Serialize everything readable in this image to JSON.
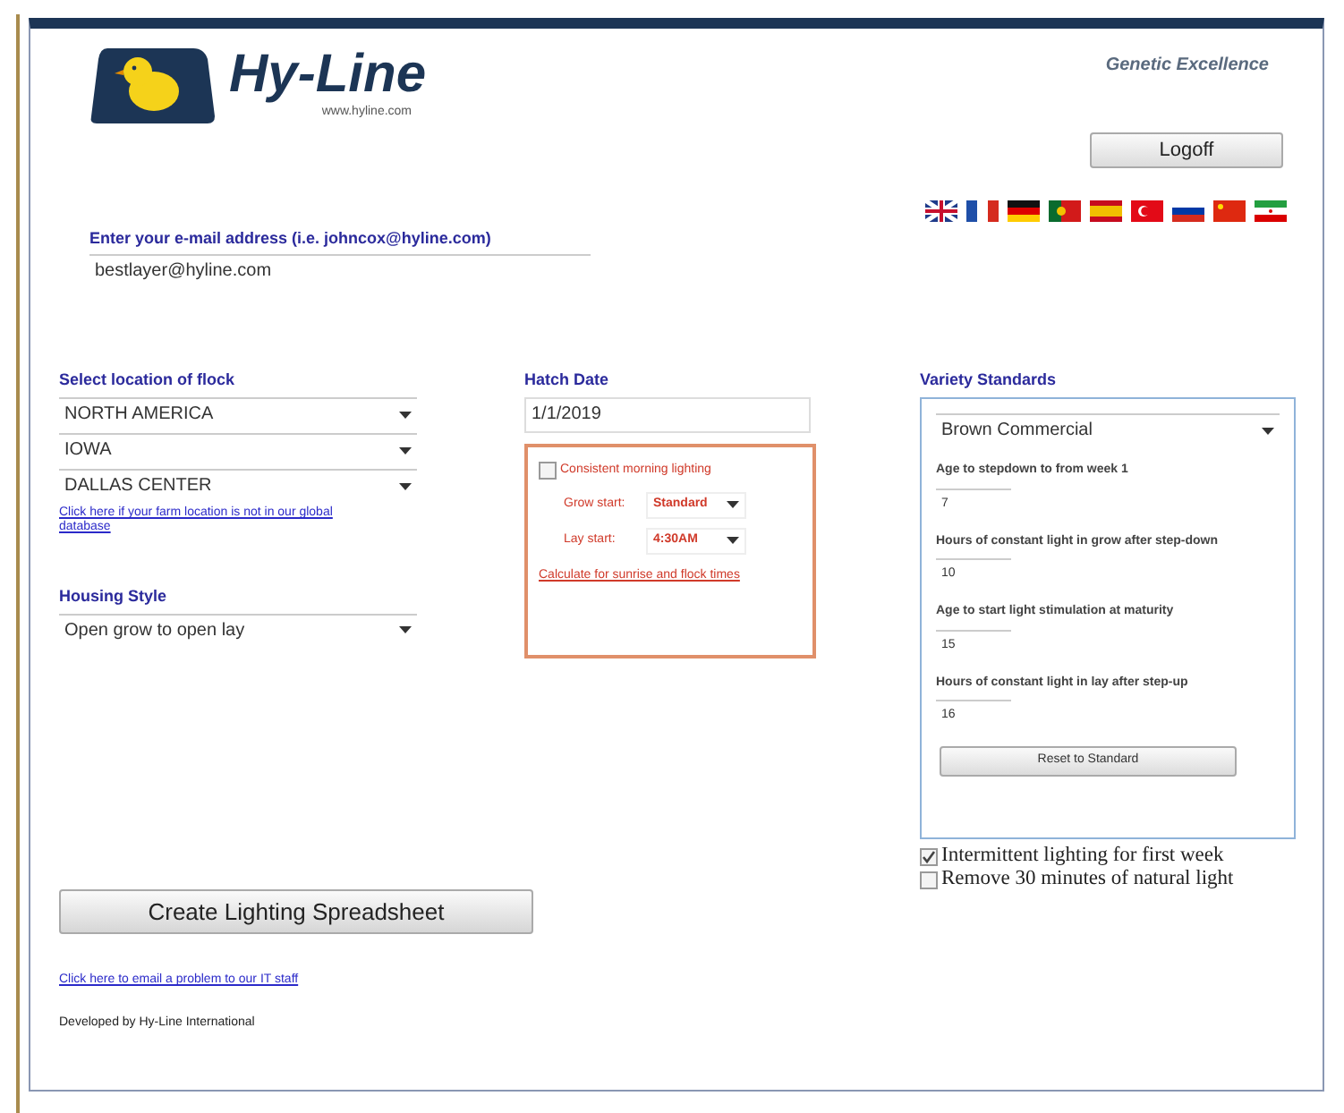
{
  "header": {
    "brand": "Hy-Line",
    "website": "www.hyline.com",
    "tagline": "Genetic Excellence",
    "logoff_button": "Logoff"
  },
  "email": {
    "label": "Enter your e-mail address (i.e. johncox@hyline.com)",
    "value": "bestlayer@hyline.com"
  },
  "location": {
    "label": "Select location of flock",
    "selects": [
      "NORTH AMERICA",
      "IOWA",
      "DALLAS CENTER"
    ],
    "link": "Click here if your farm location is not in our global database"
  },
  "housing": {
    "label": "Housing Style",
    "value": "Open grow to open lay"
  },
  "hatch": {
    "label": "Hatch Date",
    "value": "1/1/2019"
  },
  "morning_lighting": {
    "label": "Consistent morning lighting",
    "checked": false,
    "grow_start_label": "Grow start:",
    "grow_start": "Standard",
    "lay_start_label": "Lay start:",
    "lay_start": "4:30AM",
    "link": "Calculate for sunrise and flock times"
  },
  "variety": {
    "label": "Variety Standards",
    "value": "Brown Commercial",
    "fields": [
      {
        "label": "Age to stepdown to from week 1",
        "value": "7"
      },
      {
        "label": "Hours of constant light in grow after step-down",
        "value": "10"
      },
      {
        "label": "Age to start light stimulation at maturity",
        "value": "15"
      },
      {
        "label": "Hours of constant light in lay after step-up",
        "value": "16"
      }
    ],
    "reset_button": "Reset to Standard"
  },
  "options": [
    {
      "label": "Intermittent lighting for first week",
      "checked": true
    },
    {
      "label": "Remove 30 minutes of natural light",
      "checked": false
    }
  ],
  "create_button": "Create Lighting Spreadsheet",
  "footer": {
    "link": "Click here to email a problem to our IT staff",
    "credit": "Developed by Hy-Line International"
  }
}
